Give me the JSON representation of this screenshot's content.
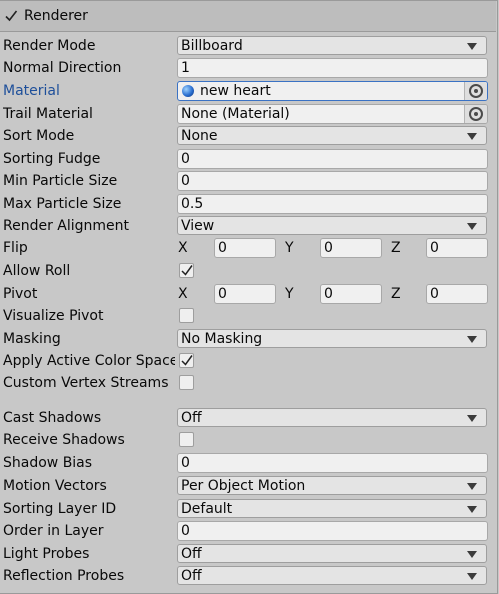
{
  "component": {
    "title": "Renderer",
    "enabled": true
  },
  "fields": {
    "render_mode": {
      "label": "Render Mode",
      "value": "Billboard"
    },
    "normal_direction": {
      "label": "Normal Direction",
      "value": "1"
    },
    "material": {
      "label": "Material",
      "value": "new heart"
    },
    "trail_material": {
      "label": "Trail Material",
      "value": "None (Material)"
    },
    "sort_mode": {
      "label": "Sort Mode",
      "value": "None"
    },
    "sorting_fudge": {
      "label": "Sorting Fudge",
      "value": "0"
    },
    "min_particle_size": {
      "label": "Min Particle Size",
      "value": "0"
    },
    "max_particle_size": {
      "label": "Max Particle Size",
      "value": "0.5"
    },
    "render_alignment": {
      "label": "Render Alignment",
      "value": "View"
    },
    "flip": {
      "label": "Flip",
      "x_label": "X",
      "x": "0",
      "y_label": "Y",
      "y": "0",
      "z_label": "Z",
      "z": "0"
    },
    "allow_roll": {
      "label": "Allow Roll",
      "checked": true
    },
    "pivot": {
      "label": "Pivot",
      "x_label": "X",
      "x": "0",
      "y_label": "Y",
      "y": "0",
      "z_label": "Z",
      "z": "0"
    },
    "visualize_pivot": {
      "label": "Visualize Pivot",
      "checked": false
    },
    "masking": {
      "label": "Masking",
      "value": "No Masking"
    },
    "apply_active_color_space": {
      "label": "Apply Active Color Space",
      "checked": true
    },
    "custom_vertex_streams": {
      "label": "Custom Vertex Streams",
      "checked": false
    },
    "cast_shadows": {
      "label": "Cast Shadows",
      "value": "Off"
    },
    "receive_shadows": {
      "label": "Receive Shadows",
      "checked": false
    },
    "shadow_bias": {
      "label": "Shadow Bias",
      "value": "0"
    },
    "motion_vectors": {
      "label": "Motion Vectors",
      "value": "Per Object Motion"
    },
    "sorting_layer_id": {
      "label": "Sorting Layer ID",
      "value": "Default"
    },
    "order_in_layer": {
      "label": "Order in Layer",
      "value": "0"
    },
    "light_probes": {
      "label": "Light Probes",
      "value": "Off"
    },
    "reflection_probes": {
      "label": "Reflection Probes",
      "value": "Off"
    }
  },
  "icons": {
    "material": "material-sphere-icon",
    "object_picker": "object-picker-icon",
    "dropdown": "chevron-down-icon",
    "checkmark": "checkmark-icon"
  }
}
